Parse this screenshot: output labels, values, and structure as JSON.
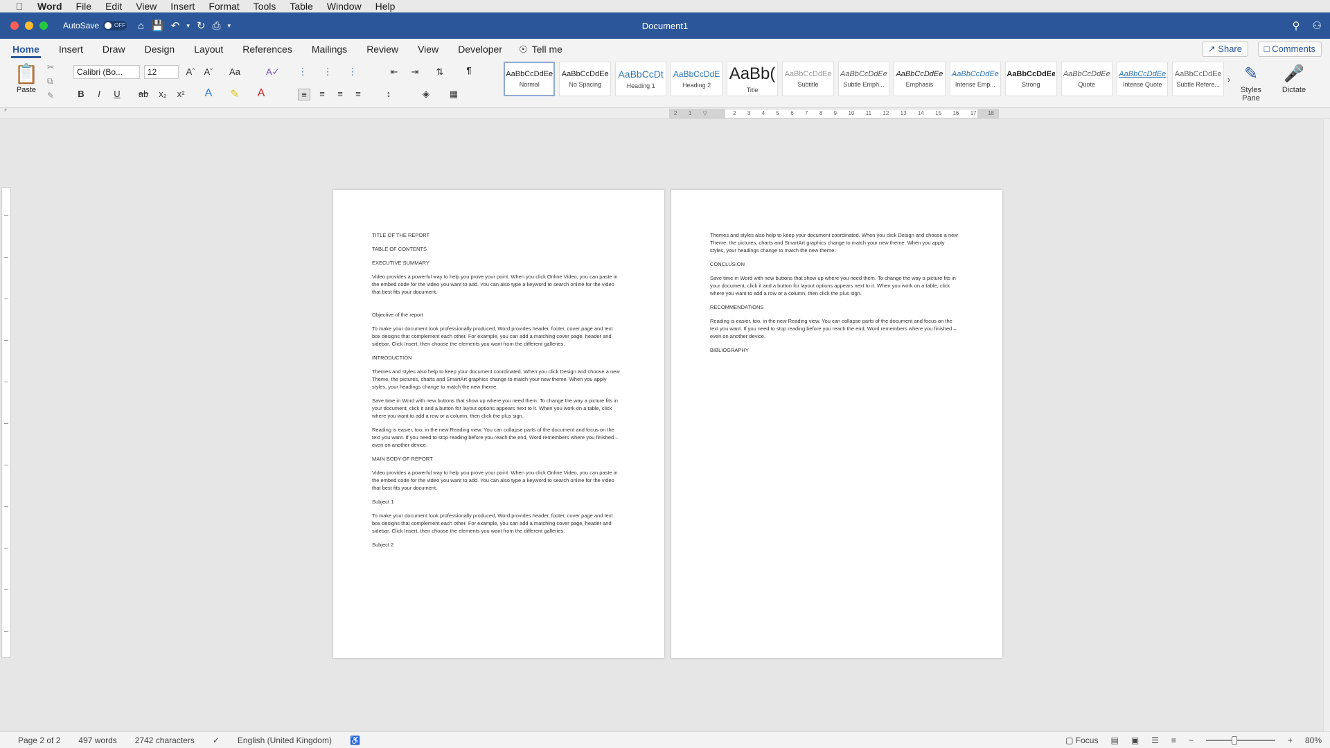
{
  "menubar": {
    "app_name": "Word",
    "items": [
      "File",
      "Edit",
      "View",
      "Insert",
      "Format",
      "Tools",
      "Table",
      "Window",
      "Help"
    ]
  },
  "titlebar": {
    "autosave_label": "AutoSave",
    "autosave_state": "OFF",
    "document_title": "Document1"
  },
  "ribbon_tabs": [
    "Home",
    "Insert",
    "Draw",
    "Design",
    "Layout",
    "References",
    "Mailings",
    "Review",
    "View",
    "Developer"
  ],
  "active_tab": "Home",
  "tell_me": "Tell me",
  "share_label": "Share",
  "comments_label": "Comments",
  "ribbon": {
    "paste_label": "Paste",
    "font_name": "Calibri (Bo...",
    "font_size": "12",
    "styles": [
      {
        "preview": "AaBbCcDdEe",
        "name": "Normal",
        "kind": "normal"
      },
      {
        "preview": "AaBbCcDdEe",
        "name": "No Spacing",
        "kind": "normal"
      },
      {
        "preview": "AaBbCcDt",
        "name": "Heading 1",
        "kind": "blue"
      },
      {
        "preview": "AaBbCcDdE",
        "name": "Heading 2",
        "kind": "blue"
      },
      {
        "preview": "AaBb(",
        "name": "Title",
        "kind": "big"
      },
      {
        "preview": "AaBbCcDdEe",
        "name": "Subtitle",
        "kind": "grey"
      },
      {
        "preview": "AaBbCcDdEe",
        "name": "Subtle Emph...",
        "kind": "normal"
      },
      {
        "preview": "AaBbCcDdEe",
        "name": "Emphasis",
        "kind": "normal"
      },
      {
        "preview": "AaBbCcDdEe",
        "name": "Intense Emp...",
        "kind": "blue"
      },
      {
        "preview": "AaBbCcDdEe",
        "name": "Strong",
        "kind": "normal"
      },
      {
        "preview": "AaBbCcDdEe",
        "name": "Quote",
        "kind": "normal"
      },
      {
        "preview": "AaBbCcDdEe",
        "name": "Intense Quote",
        "kind": "blue"
      },
      {
        "preview": "AaBbCcDdEe",
        "name": "Subtle Refere...",
        "kind": "normal"
      }
    ],
    "styles_pane_label": "Styles Pane",
    "dictate_label": "Dictate"
  },
  "ruler_numbers": [
    "2",
    "1",
    "",
    "1",
    "2",
    "3",
    "4",
    "5",
    "6",
    "7",
    "8",
    "9",
    "10",
    "11",
    "12",
    "13",
    "14",
    "15",
    "16",
    "17",
    "18"
  ],
  "page1": [
    "TITLE OF THE REPORT",
    "TABLE OF CONTENTS",
    "EXECUTIVE SUMMARY",
    "Video provides a powerful way to help you prove your point. When you click Online Video, you can paste in the embed code for the video you want to add. You can also type a keyword to search online for the video that best fits your document.",
    "Objective of the report",
    "To make your document look professionally produced, Word provides header, footer, cover page and text box designs that complement each other. For example, you can add a matching cover page, header and sidebar. Click Insert, then choose the elements you want from the different galleries.",
    "INTRODUCTION",
    "Themes and styles also help to keep your document coordinated. When you click Design and choose a new Theme, the pictures, charts and SmartArt graphics change to match your new theme. When you apply styles, your headings change to match the new theme.",
    "Save time in Word with new buttons that show up where you need them. To change the way a picture fits in your document, click it and a button for layout options appears next to it. When you work on a table, click where you want to add a row or a column, then click the plus sign.",
    "Reading is easier, too, in the new Reading view. You can collapse parts of the document and focus on the text you want. If you need to stop reading before you reach the end, Word remembers where you finished – even on another device.",
    "MAIN BODY OF REPORT",
    "Video provides a powerful way to help you prove your point. When you click Online Video, you can paste in the embed code for the video you want to add. You can also type a keyword to search online for the video that best fits your document.",
    "Subject 1",
    "To make your document look professionally produced, Word provides header, footer, cover page and text box designs that complement each other. For example, you can add a matching cover page, header and sidebar. Click Insert, then choose the elements you want from the different galleries.",
    "Subject 2"
  ],
  "page2": [
    "Themes and styles also help to keep your document coordinated. When you click Design and choose a new Theme, the pictures, charts and SmartArt graphics change to match your new theme. When you apply styles, your headings change to match the new theme.",
    "CONCLUSION",
    "Save time in Word with new buttons that show up where you need them. To change the way a picture fits in your document, click it and a button for layout options appears next to it. When you work on a table, click where you want to add a row or a column, then click the plus sign.",
    "RECOMMENDATIONS",
    "Reading is easier, too, in the new Reading view. You can collapse parts of the document and focus on the text you want. If you need to stop reading before you reach the end, Word remembers where you finished – even on another device.",
    "BIBLIOGRAPHY"
  ],
  "statusbar": {
    "page": "Page 2 of 2",
    "words": "497 words",
    "characters": "2742 characters",
    "language": "English (United Kingdom)",
    "focus": "Focus",
    "zoom": "80%",
    "zoom_fraction": 0.4
  }
}
